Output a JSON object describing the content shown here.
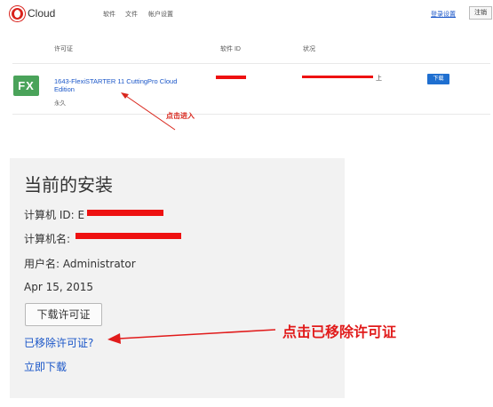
{
  "header": {
    "brand": "Cloud",
    "nav": [
      "软件",
      "文件",
      "帐户设置"
    ],
    "settings_link": "登录设置",
    "logout_button": "注销"
  },
  "table": {
    "columns": [
      "许可证",
      "软件 ID",
      "状况"
    ],
    "rows": [
      {
        "icon_text": "FX",
        "license_name": "1643-FlexiSTARTER 11 CuttingPro Cloud Edition",
        "term": "永久",
        "status_suffix": "上",
        "download_label": "下载"
      }
    ]
  },
  "annotations": {
    "click_to_enter": "点击进入",
    "click_removed_license": "点击已移除许可证"
  },
  "install_panel": {
    "title": "当前的安装",
    "computer_id_label": "计算机 ID: E",
    "computer_name_label": "计算机名:",
    "username": "用户名: Administrator",
    "date": "Apr 15, 2015",
    "download_license_button": "下载许可证",
    "removed_license_link": "已移除许可证?",
    "download_now_link": "立即下载"
  },
  "colors": {
    "accent_red": "#e11b1b",
    "link_blue": "#1a56c8",
    "button_blue": "#1f6fd0",
    "fx_green": "#4aa35a"
  }
}
